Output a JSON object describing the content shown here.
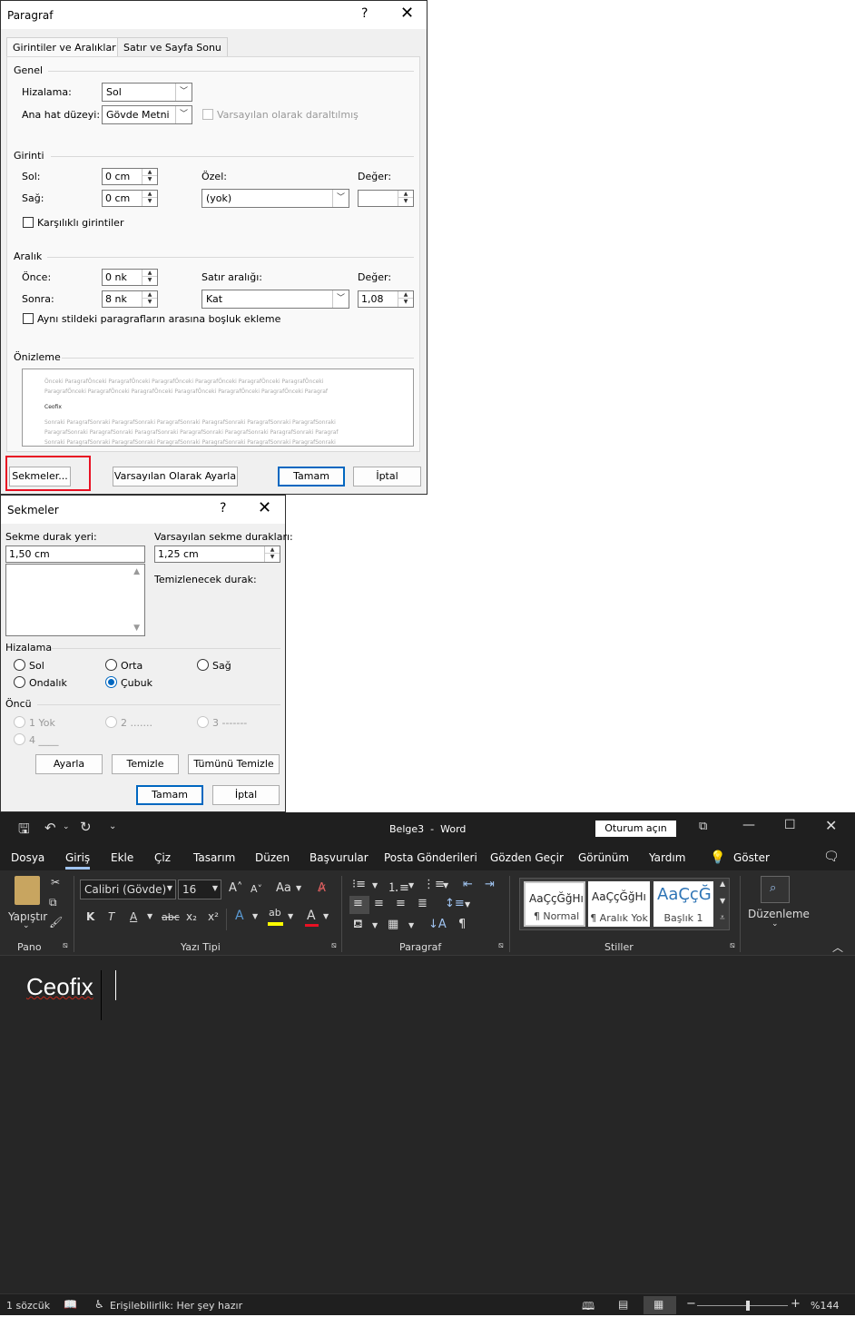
{
  "paragraf_dialog": {
    "title": "Paragraf",
    "help": "?",
    "close": "✕",
    "tabs": [
      "Girintiler ve Aralıklar",
      "Satır ve Sayfa Sonu"
    ],
    "genel": {
      "heading": "Genel",
      "hizalama_label": "Hizalama:",
      "hizalama_value": "Sol",
      "anahat_label": "Ana hat düzeyi:",
      "anahat_value": "Gövde Metni",
      "daraltilmis_label": "Varsayılan olarak daraltılmış"
    },
    "girinti": {
      "heading": "Girinti",
      "sol_label": "Sol:",
      "sol_value": "0 cm",
      "sag_label": "Sağ:",
      "sag_value": "0 cm",
      "ozel_label": "Özel:",
      "ozel_value": "(yok)",
      "deger_label": "Değer:",
      "deger_value": "",
      "karsilikli_label": "Karşılıklı girintiler"
    },
    "aralik": {
      "heading": "Aralık",
      "once_label": "Önce:",
      "once_value": "0 nk",
      "sonra_label": "Sonra:",
      "sonra_value": "8 nk",
      "satir_label": "Satır aralığı:",
      "satir_value": "Kat",
      "deger_label": "Değer:",
      "deger_value": "1,08",
      "ayni_stil_label": "Aynı stildeki paragrafların arasına boşluk ekleme"
    },
    "onizleme": {
      "heading": "Önizleme",
      "prev_line1": "Önceki ParagrafÖnceki ParagrafÖnceki ParagrafÖnceki ParagrafÖnceki ParagrafÖnceki ParagrafÖnceki",
      "prev_line2": "ParagrafÖnceki ParagrafÖnceki ParagrafÖnceki ParagrafÖnceki ParagrafÖnceki ParagrafÖnceki Paragraf",
      "sample": "Ceofix",
      "next_line1": "Sonraki ParagrafSonraki ParagrafSonraki ParagrafSonraki ParagrafSonraki ParagrafSonraki ParagrafSonraki",
      "next_line2": "ParagrafSonraki ParagrafSonraki ParagrafSonraki ParagrafSonraki ParagrafSonraki ParagrafSonraki Paragraf",
      "next_line3": "Sonraki ParagrafSonraki ParagrafSonraki ParagrafSonraki ParagrafSonraki ParagrafSonraki ParagrafSonraki",
      "next_line4": "ParagrafSonraki ParagrafSonraki ParagrafSonraki ParagrafSonraki ParagrafSonraki ParagrafSonraki Paragraf"
    },
    "buttons": {
      "sekmeler": "Sekmeler...",
      "varsayilan": "Varsayılan Olarak Ayarla",
      "tamam": "Tamam",
      "iptal": "İptal"
    },
    "highlight_color": "#e81123"
  },
  "sekmeler_dialog": {
    "title": "Sekmeler",
    "help": "?",
    "close": "✕",
    "durak_label": "Sekme durak yeri:",
    "durak_value": "1,50 cm",
    "varsayilan_label": "Varsayılan sekme durakları:",
    "varsayilan_value": "1,25 cm",
    "temizlenecek_label": "Temizlenecek durak:",
    "hizalama_heading": "Hizalama",
    "hizalama": [
      "Sol",
      "Orta",
      "Sağ",
      "Ondalık",
      "Çubuk"
    ],
    "hizalama_selected": "Çubuk",
    "oncu_heading": "Öncü",
    "oncu": [
      "1 Yok",
      "2 .......",
      "3 -------",
      "4 ____"
    ],
    "buttons": {
      "ayarla": "Ayarla",
      "temizle": "Temizle",
      "tumunu": "Tümünü Temizle",
      "tamam": "Tamam",
      "iptal": "İptal"
    }
  },
  "word": {
    "doc_title": "Belge3",
    "separator": "-",
    "app_name": "Word",
    "signin": "Oturum açın",
    "menu": [
      "Dosya",
      "Giriş",
      "Ekle",
      "Çiz",
      "Tasarım",
      "Düzen",
      "Başvurular",
      "Posta Gönderileri",
      "Gözden Geçir",
      "Görünüm",
      "Yardım"
    ],
    "active_menu": "Giriş",
    "goster": "Göster",
    "ribbon": {
      "yapistir": "Yapıştır",
      "pano": "Pano",
      "font_name": "Calibri (Gövde)",
      "font_size": "16",
      "aa": "Aa",
      "yazi_tipi": "Yazı Tipi",
      "paragraf": "Paragraf",
      "stiller": "Stiller",
      "style_sample": "AaÇçĞğHı",
      "style_sample_big": "AaÇçĞ",
      "style_normal": "¶ Normal",
      "style_aralik": "¶ Aralık Yok",
      "style_baslik": "Başlık 1",
      "duzenleme": "Düzenleme",
      "bold": "K",
      "italic": "T",
      "underline": "A",
      "strike": "abc",
      "sub": "x₂",
      "sup": "x²"
    },
    "document_text": "Ceofix",
    "status": {
      "words": "1 sözcük",
      "accessibility": "Erişilebilirlik: Her şey hazır",
      "zoom": "%144",
      "zoom_level": 1.44
    },
    "accent_color": "#9fc3f0"
  }
}
